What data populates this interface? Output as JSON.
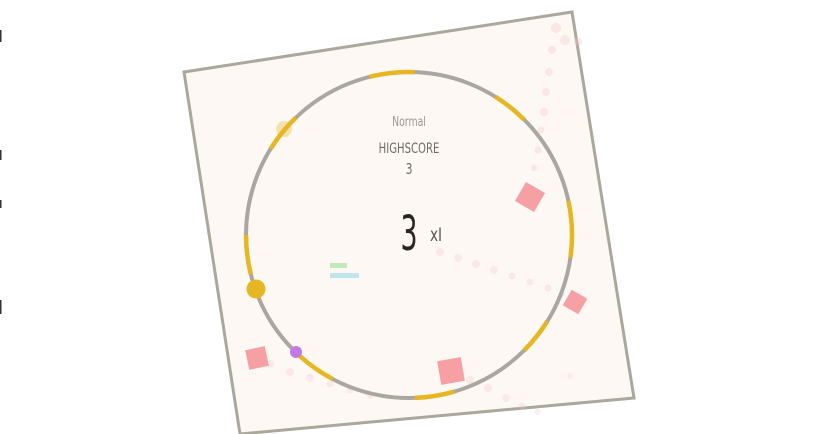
{
  "game": {
    "mode": "Normal",
    "highscore_label": "HIGHSCORE",
    "highscore": "3",
    "score": "3",
    "multiplier": "xI"
  },
  "colors": {
    "background": "#ffffff",
    "board_fill": "#fdf8f4",
    "board_border": "#aaa79c",
    "ring": "#aaa7a0",
    "ring_segment": "#e6b623",
    "player": "#e6b623",
    "enemy_dot": "#c47ae6",
    "hazard_square": "#f6a0a4",
    "trail": "#f6c6c8",
    "powerup_green": "#c2e9b8",
    "powerup_cyan": "#bfe6ec"
  }
}
